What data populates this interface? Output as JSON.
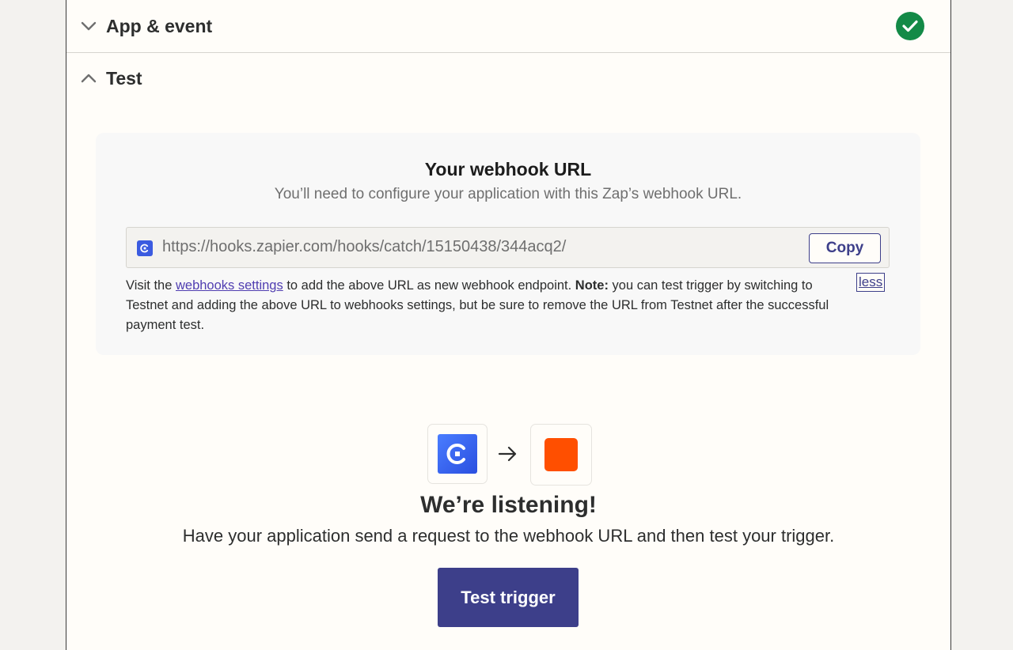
{
  "sections": {
    "app_event": {
      "title": "App & event",
      "status": "complete"
    },
    "test": {
      "title": "Test"
    }
  },
  "webhook_card": {
    "title": "Your webhook URL",
    "subtitle": "You’ll need to configure your application with this Zap’s webhook URL.",
    "url": "https://hooks.zapier.com/hooks/catch/15150438/344acq2/",
    "copy_label": "Copy",
    "help": {
      "prefix": "Visit the ",
      "link": "webhooks settings",
      "middle": " to add the above URL as new webhook endpoint. ",
      "note_label": "Note:",
      "suffix": " you can test trigger by switching to Testnet and adding the above URL to webhooks settings, but be sure to remove the URL from Testnet after the successful payment test."
    },
    "less_label": "less"
  },
  "listening": {
    "title": "We’re listening!",
    "subtitle": "Have your application send a request to the webhook URL and then test your trigger.",
    "button_label": "Test trigger"
  },
  "colors": {
    "accent": "#3d3f8a",
    "success": "#138a47",
    "zapier_orange": "#ff4f00",
    "coinbase_blue": "#3b5be0"
  },
  "icons": {
    "app_event_chevron": "chevron-down-icon",
    "test_chevron": "chevron-up-icon",
    "status": "check-circle-icon",
    "flow_arrow": "arrow-right-icon"
  }
}
